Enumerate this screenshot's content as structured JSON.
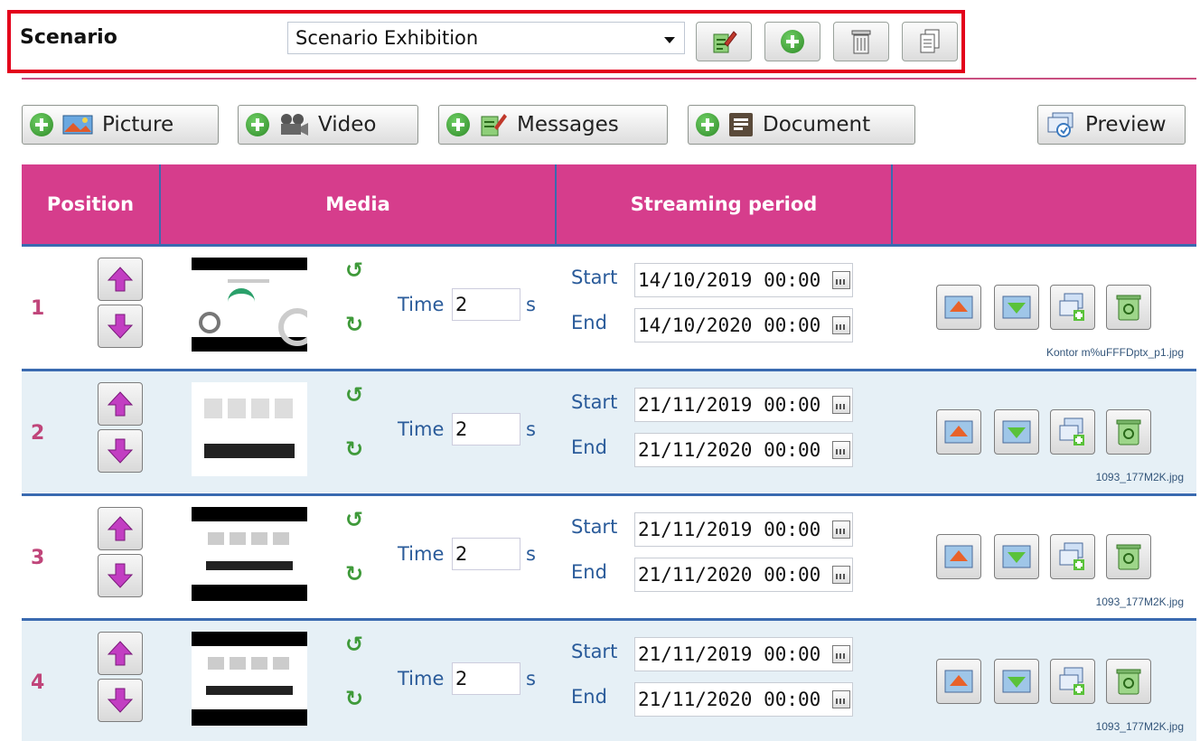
{
  "scenario": {
    "label": "Scenario",
    "selected": "Scenario Exhibition",
    "buttons": [
      "edit-icon",
      "add-icon",
      "trash-icon",
      "copy-icon"
    ]
  },
  "toolbar": {
    "picture": "Picture",
    "video": "Video",
    "messages": "Messages",
    "document": "Document",
    "preview": "Preview"
  },
  "table": {
    "headers": {
      "position": "Position",
      "media": "Media",
      "period": "Streaming period",
      "actions": ""
    },
    "rows": [
      {
        "position": "1",
        "time_label": "Time",
        "time": "2",
        "unit": "s",
        "start_label": "Start",
        "start": "14/10/2019 00:00",
        "end_label": "End",
        "end": "14/10/2020 00:00",
        "file": "Kontor m%uFFFDptx_p1.jpg"
      },
      {
        "position": "2",
        "time_label": "Time",
        "time": "2",
        "unit": "s",
        "start_label": "Start",
        "start": "21/11/2019 00:00",
        "end_label": "End",
        "end": "21/11/2020 00:00",
        "file": "1093_177M2K.jpg"
      },
      {
        "position": "3",
        "time_label": "Time",
        "time": "2",
        "unit": "s",
        "start_label": "Start",
        "start": "21/11/2019 00:00",
        "end_label": "End",
        "end": "21/11/2020 00:00",
        "file": "1093_177M2K.jpg"
      },
      {
        "position": "4",
        "time_label": "Time",
        "time": "2",
        "unit": "s",
        "start_label": "Start",
        "start": "21/11/2019 00:00",
        "end_label": "End",
        "end": "21/11/2020 00:00",
        "file": "1093_177M2K.jpg"
      }
    ]
  },
  "colors": {
    "header_bg": "#d63d8c",
    "highlight_border": "#e3001b",
    "row_alt": "#e6f0f6",
    "grid_blue": "#3a6ab0"
  }
}
